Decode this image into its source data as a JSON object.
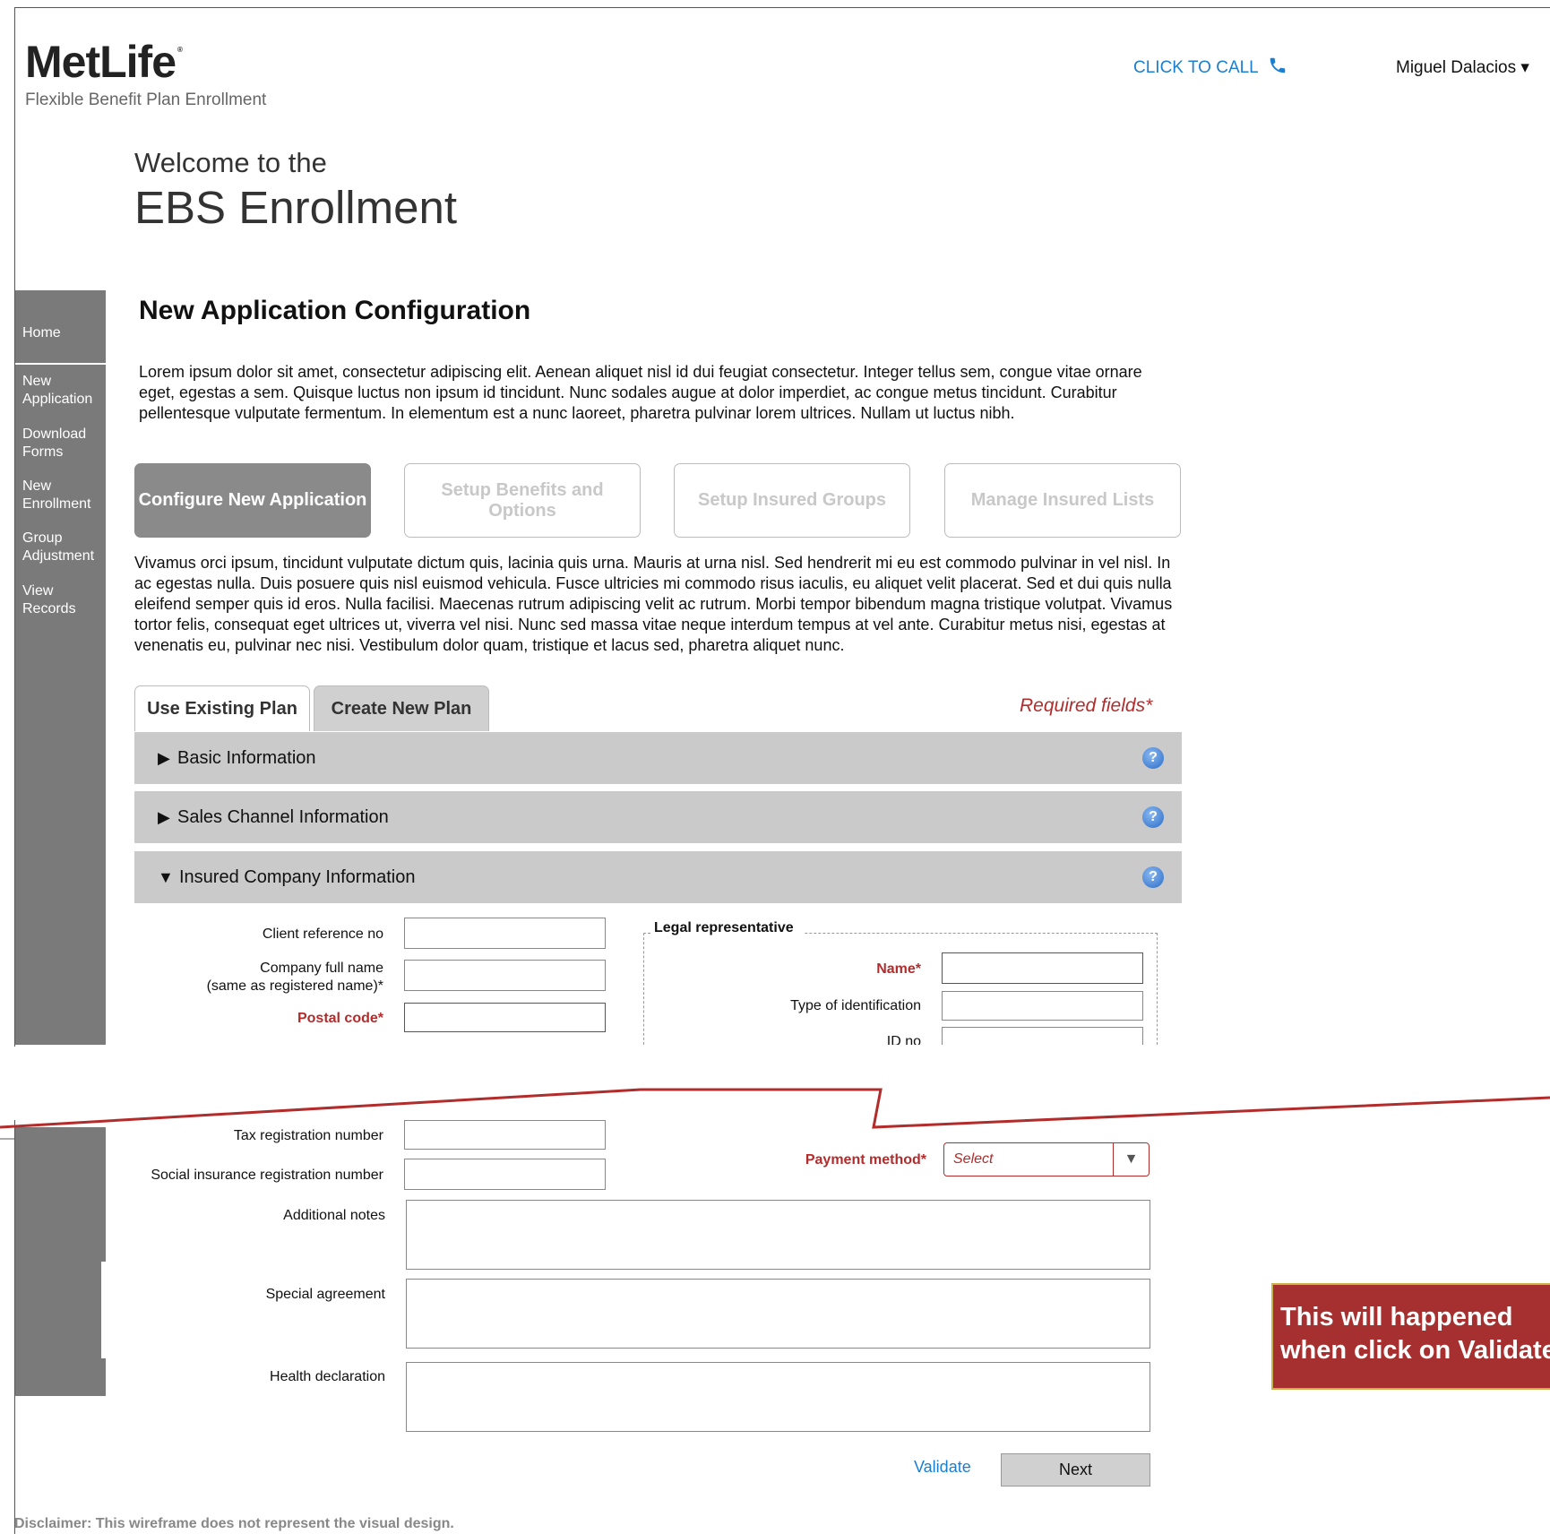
{
  "header": {
    "logo_text": "MetLife",
    "tagline": "Flexible Benefit Plan Enrollment",
    "click_to_call": "CLICK TO CALL",
    "user_name": "Miguel Dalacios ▾"
  },
  "welcome": {
    "line1": "Welcome to the",
    "line2": "EBS Enrollment"
  },
  "sidebar": {
    "items": [
      {
        "label": "Home"
      },
      {
        "label": "New\nApplication"
      },
      {
        "label": "Download\nForms"
      },
      {
        "label": "New\nEnrollment"
      },
      {
        "label": "Group\nAdjustment"
      },
      {
        "label": "View\nRecords"
      }
    ]
  },
  "main": {
    "title": "New Application Configuration",
    "intro": "Lorem ipsum dolor sit amet, consectetur adipiscing elit. Aenean aliquet nisl id dui feugiat consectetur. Integer tellus sem, congue vitae ornare eget, egestas a sem. Quisque luctus non ipsum id tincidunt. Nunc sodales augue at dolor imperdiet, ac congue metus tincidunt. Curabitur pellentesque vulputate fermentum. In elementum est a nunc laoreet, pharetra pulvinar lorem ultrices. Nullam ut luctus nibh.",
    "steps": [
      {
        "label": "Configure New Application"
      },
      {
        "label": "Setup Benefits and Options"
      },
      {
        "label": "Setup Insured Groups"
      },
      {
        "label": "Manage Insured Lists"
      }
    ],
    "body": "Vivamus orci ipsum, tincidunt vulputate dictum quis, lacinia quis urna. Mauris at urna nisl. Sed hendrerit mi eu est commodo pulvinar in vel nisl. In ac egestas nulla. Duis posuere quis nisl euismod vehicula. Fusce ultricies mi commodo risus iaculis, eu aliquet velit placerat. Sed et dui quis nulla eleifend semper quis id eros. Nulla facilisi. Maecenas rutrum adipiscing velit ac rutrum. Morbi tempor bibendum magna tristique volutpat. Vivamus tortor felis, consequat eget ultrices ut, viverra vel nisi. Nunc sed massa vitae neque interdum tempus at vel ante. Curabitur metus nisi, egestas at venenatis eu, pulvinar nec nisi. Vestibulum dolor quam, tristique et lacus sed, pharetra aliquet nunc.",
    "tabs": [
      {
        "label": "Use Existing Plan"
      },
      {
        "label": "Create New Plan"
      }
    ],
    "required_note": "Required fields*",
    "accordions": [
      {
        "label": "Basic Information",
        "arrow": "▶"
      },
      {
        "label": "Sales Channel Information",
        "arrow": "▶"
      },
      {
        "label": "Insured Company Information",
        "arrow": "▼"
      }
    ]
  },
  "form": {
    "client_ref": "Client reference no",
    "company_name": "Company full name",
    "company_name_note": "(same as registered name)*",
    "postal_code": "Postal code*",
    "legal_rep_title": "Legal representative",
    "name": "Name*",
    "id_type": "Type of identification",
    "id_no": "ID no",
    "tax_reg": "Tax registration number",
    "social_ins": "Social insurance registration number",
    "payment_method": "Payment method*",
    "payment_select": "Select",
    "additional_notes": "Additional notes",
    "special_agreement": "Special agreement",
    "health_declaration": "Health declaration",
    "validate": "Validate",
    "next": "Next"
  },
  "callout": {
    "text": "This will happened when click on Validate"
  },
  "disclaimer": "Disclaimer: This wireframe does not represent the visual design.",
  "colors": {
    "accent_blue": "#1a7fd1",
    "required_red": "#b22c2c",
    "sidebar_gray": "#7a7a7a",
    "callout_red": "#a63030"
  }
}
